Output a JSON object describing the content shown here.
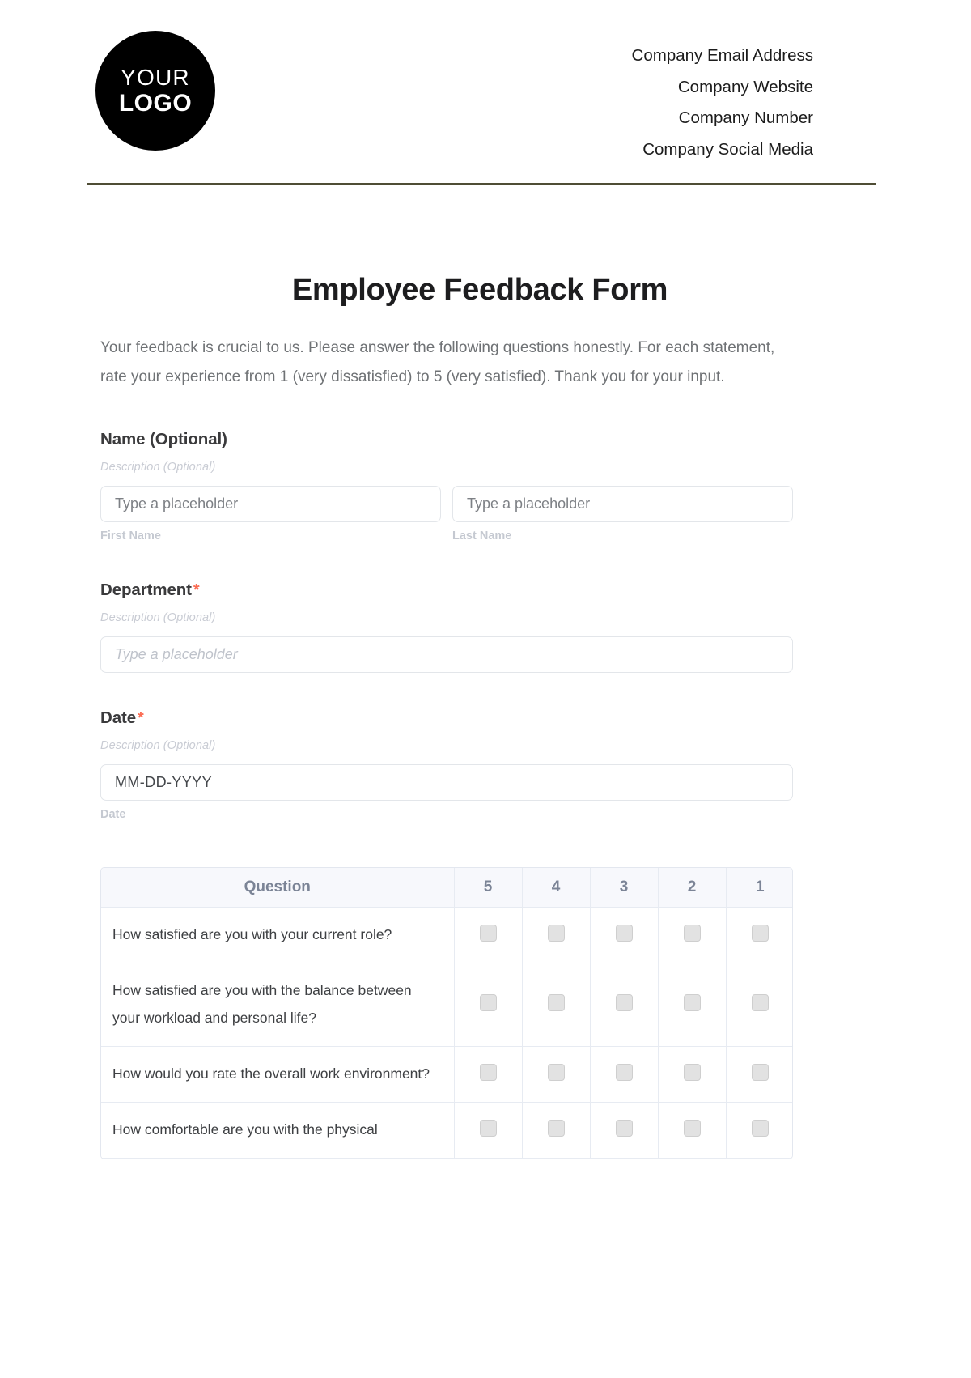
{
  "header": {
    "logo": {
      "top_text": "YOUR",
      "bottom_text": "LOGO"
    },
    "contact_lines": [
      "Company Email Address",
      "Company Website",
      "Company Number",
      "Company Social Media"
    ],
    "divider_color": "#4f4d35"
  },
  "document": {
    "title": "Employee Feedback Form",
    "intro": "Your feedback is crucial to us. Please answer the following questions honestly. For each statement, rate your experience from 1 (very dissatisfied) to 5 (very satisfied). Thank you for your input."
  },
  "fields": {
    "name": {
      "label": "Name (Optional)",
      "description": "Description (Optional)",
      "first_placeholder": "Type a placeholder",
      "last_placeholder": "Type a placeholder",
      "first_sublabel": "First Name",
      "last_sublabel": "Last Name"
    },
    "department": {
      "label": "Department",
      "required_marker": "*",
      "description": "Description (Optional)",
      "placeholder": "Type a placeholder"
    },
    "date": {
      "label": "Date",
      "required_marker": "*",
      "description": "Description (Optional)",
      "value": "MM-DD-YYYY",
      "sublabel": "Date"
    }
  },
  "matrix": {
    "columns": [
      "Question",
      "5",
      "4",
      "3",
      "2",
      "1"
    ],
    "rows": [
      "How satisfied are you with your current role?",
      "How satisfied are you with the balance between your workload and personal life?",
      "How would you rate the overall work environment?",
      "How comfortable are you with the physical"
    ]
  },
  "colors": {
    "accent_required": "#fb6b52",
    "rule": "#4f4d35",
    "table_header_bg": "#f7f8fc",
    "table_header_text": "#7b8496"
  }
}
